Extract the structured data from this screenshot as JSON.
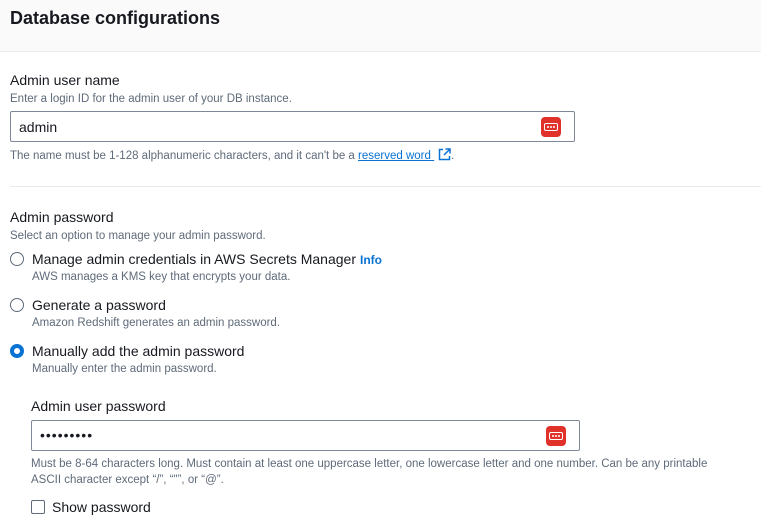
{
  "section": {
    "title": "Database configurations"
  },
  "admin_user": {
    "label": "Admin user name",
    "description": "Enter a login ID for the admin user of your DB instance.",
    "value": "admin",
    "constraint_prefix": "The name must be 1-128 alphanumeric characters, and it can't be a",
    "constraint_link": "reserved word",
    "constraint_suffix": "."
  },
  "admin_password": {
    "label": "Admin password",
    "description": "Select an option to manage your admin password.",
    "options": [
      {
        "label": "Manage admin credentials in AWS Secrets Manager",
        "info": "Info",
        "description": "AWS manages a KMS key that encrypts your data.",
        "selected": false
      },
      {
        "label": "Generate a password",
        "description": "Amazon Redshift generates an admin password.",
        "selected": false
      },
      {
        "label": "Manually add the admin password",
        "description": "Manually enter the admin password.",
        "selected": true
      }
    ],
    "user_password": {
      "label": "Admin user password",
      "value": "•••••••••",
      "constraint_line1": "Must be 8-64 characters long. Must contain at least one uppercase letter, one lowercase letter and one number. Can be any printable",
      "constraint_line2": "ASCII character except “/”, “\"”, or “@”.",
      "show_password_label": "Show password",
      "show_password_checked": false
    }
  },
  "colors": {
    "accent": "#0972d3",
    "key_icon": "#e0312b"
  },
  "icons": {
    "password_manager": "password-key-icon",
    "external_link": "external-link-icon"
  }
}
